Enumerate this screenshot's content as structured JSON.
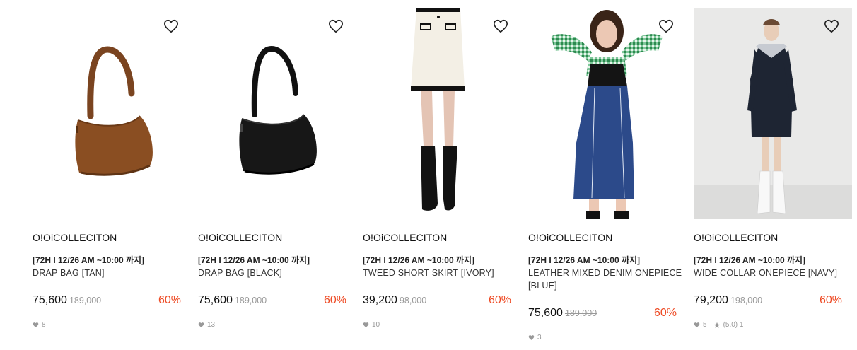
{
  "products": [
    {
      "brand": "O!OiCOLLECITON",
      "promo": "[72H I 12/26 AM ~10:00 까지]",
      "name": "DRAP BAG [TAN]",
      "price": "75,600",
      "original_price": "189,000",
      "discount": "60%",
      "likes": "8",
      "image": "brown-shoulder-bag",
      "color": "#8a4e22"
    },
    {
      "brand": "O!OiCOLLECITON",
      "promo": "[72H I 12/26 AM ~10:00 까지]",
      "name": "DRAP BAG [BLACK]",
      "price": "75,600",
      "original_price": "189,000",
      "discount": "60%",
      "likes": "13",
      "image": "black-shoulder-bag",
      "color": "#161616"
    },
    {
      "brand": "O!OiCOLLECITON",
      "promo": "[72H I 12/26 AM ~10:00 까지]",
      "name": "TWEED SHORT SKIRT [IVORY]",
      "price": "39,200",
      "original_price": "98,000",
      "discount": "60%",
      "likes": "10",
      "image": "ivory-tweed-skirt-model",
      "color": "#f3efe5"
    },
    {
      "brand": "O!OiCOLLECITON",
      "promo": "[72H I 12/26 AM ~10:00 까지]",
      "name": "LEATHER MIXED DENIM ONEPIECE [BLUE]",
      "price": "75,600",
      "original_price": "189,000",
      "discount": "60%",
      "likes": "3",
      "image": "denim-onepiece-model",
      "color": "#2c4a8a"
    },
    {
      "brand": "O!OiCOLLECITON",
      "promo": "[72H I 12/26 AM ~10:00 까지]",
      "name": "WIDE COLLAR ONEPIECE [NAVY]",
      "price": "79,200",
      "original_price": "198,000",
      "discount": "60%",
      "likes": "5",
      "rating": "(5.0) 1",
      "image": "navy-collar-onepiece-model",
      "color": "#1e2533"
    }
  ],
  "colors": {
    "discount": "#ee4b25",
    "meta": "#999999",
    "strike": "#999999"
  }
}
